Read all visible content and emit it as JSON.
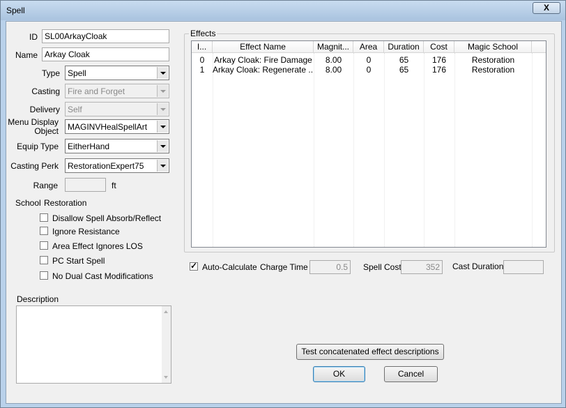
{
  "window": {
    "title": "Spell",
    "close": "X"
  },
  "form": {
    "id_label": "ID",
    "id_value": "SL00ArkayCloak",
    "name_label": "Name",
    "name_value": "Arkay Cloak",
    "type_label": "Type",
    "type_value": "Spell",
    "casting_label": "Casting",
    "casting_value": "Fire and Forget",
    "delivery_label": "Delivery",
    "delivery_value": "Self",
    "menu_display_label_1": "Menu Display",
    "menu_display_label_2": "Object",
    "menu_display_value": "MAGINVHealSpellArt",
    "equip_type_label": "Equip Type",
    "equip_type_value": "EitherHand",
    "casting_perk_label": "Casting Perk",
    "casting_perk_value": "RestorationExpert75",
    "range_label": "Range",
    "range_value": "",
    "range_unit": "ft",
    "school_label": "School",
    "school_value": "Restoration"
  },
  "checkboxes": [
    {
      "label": "Disallow Spell Absorb/Reflect",
      "checked": false
    },
    {
      "label": "Ignore Resistance",
      "checked": false
    },
    {
      "label": "Area Effect Ignores LOS",
      "checked": false
    },
    {
      "label": "PC Start Spell",
      "checked": false
    },
    {
      "label": "No Dual Cast Modifications",
      "checked": false
    }
  ],
  "description": {
    "label": "Description",
    "value": ""
  },
  "effects": {
    "group_label": "Effects",
    "columns": [
      "I...",
      "Effect Name",
      "Magnit...",
      "Area",
      "Duration",
      "Cost",
      "Magic School"
    ],
    "rows": [
      [
        "0",
        "Arkay Cloak: Fire Damage",
        "8.00",
        "0",
        "65",
        "176",
        "Restoration"
      ],
      [
        "1",
        "Arkay Cloak: Regenerate ...",
        "8.00",
        "0",
        "65",
        "176",
        "Restoration"
      ]
    ]
  },
  "calc": {
    "auto_calculate_label": "Auto-Calculate",
    "auto_calculate_checked": true,
    "charge_time_label": "Charge Time",
    "charge_time_value": "0.5",
    "spell_cost_label": "Spell Cost",
    "spell_cost_value": "352",
    "cast_duration_label": "Cast Duration",
    "cast_duration_value": ""
  },
  "buttons": {
    "test_label": "Test concatenated effect descriptions",
    "ok_label": "OK",
    "cancel_label": "Cancel"
  }
}
